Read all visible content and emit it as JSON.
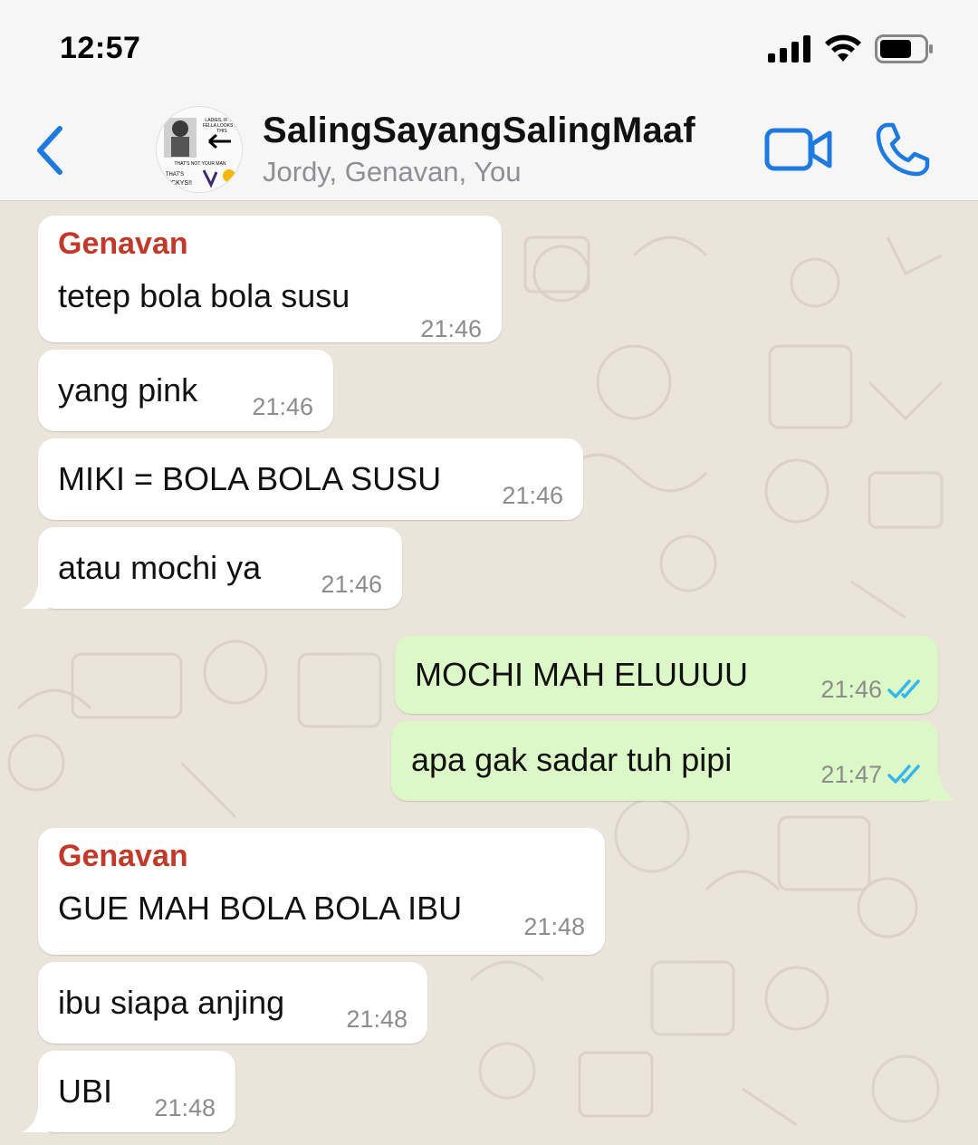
{
  "status_bar": {
    "time": "12:57"
  },
  "header": {
    "title": "SalingSayangSalingMaaf",
    "subtitle": "Jordy, Genavan, You",
    "avatar_text": {
      "line1": "LADIES, IF YOU",
      "line2": "FELLA LOOKS LIK",
      "line3": "THIS",
      "line4": "THAT'S NOT YOUR MAN",
      "line5": "THAT'S",
      "line6": "NICKYS!!"
    }
  },
  "messages": [
    {
      "direction": "in",
      "sender": "Genavan",
      "text": "tetep bola bola susu",
      "time": "21:46"
    },
    {
      "direction": "in",
      "sender": "",
      "text": "yang pink",
      "time": "21:46"
    },
    {
      "direction": "in",
      "sender": "",
      "text": "MIKI = BOLA BOLA SUSU",
      "time": "21:46"
    },
    {
      "direction": "in",
      "sender": "",
      "text": "atau mochi ya",
      "time": "21:46"
    },
    {
      "direction": "out",
      "text": "MOCHI MAH ELUUUU",
      "time": "21:46",
      "status": "read"
    },
    {
      "direction": "out",
      "text": "apa gak sadar tuh pipi",
      "time": "21:47",
      "status": "read"
    },
    {
      "direction": "in",
      "sender": "Genavan",
      "text": "GUE MAH BOLA BOLA IBU",
      "time": "21:48"
    },
    {
      "direction": "in",
      "sender": "",
      "text": "ibu siapa anjing",
      "time": "21:48"
    },
    {
      "direction": "in",
      "sender": "",
      "text": "UBI",
      "time": "21:48"
    }
  ],
  "colors": {
    "accent": "#1f7ae0",
    "sender_name": "#c0392b",
    "outgoing_bubble": "#dcf8c6",
    "incoming_bubble": "#ffffff",
    "read_check": "#34b7f1"
  },
  "icons": [
    "back-chevron-icon",
    "video-call-icon",
    "phone-icon",
    "signal-icon",
    "wifi-icon",
    "battery-icon",
    "double-check-icon"
  ]
}
